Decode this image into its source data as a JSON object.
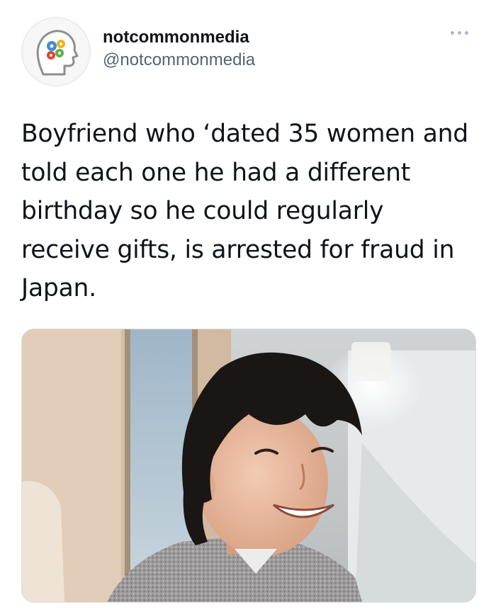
{
  "tweet": {
    "author": {
      "display_name": "notcommonmedia",
      "handle": "@notcommonmedia",
      "avatar_icon": "head-with-gears-icon"
    },
    "more_icon": "more-options-icon",
    "text": "Boyfriend who ‘dated 35 women and told each one he had a different birthday so he could regularly receive gifts, is arrested for fraud in Japan.",
    "media": {
      "type": "photo",
      "description_icon": "smiling-man-photo"
    }
  },
  "colors": {
    "text_primary": "#0f1419",
    "text_secondary": "#536471",
    "more_dots": "#aab8c2"
  }
}
